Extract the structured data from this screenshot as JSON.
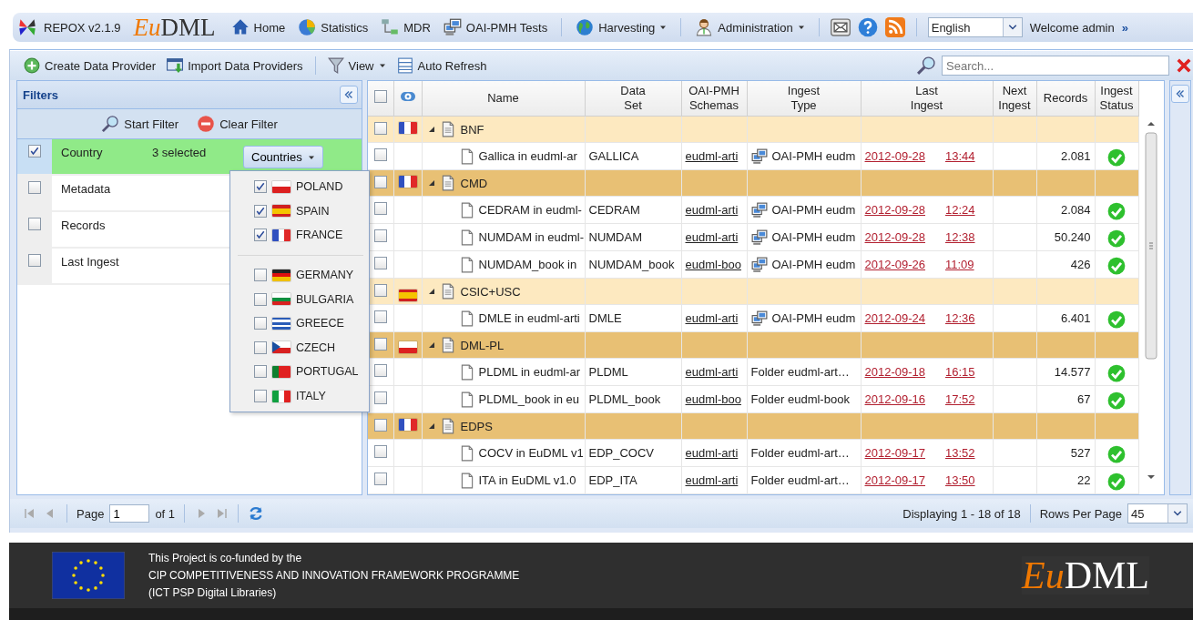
{
  "app": {
    "name": "REPOX v2.1.9",
    "logo_accent": "Eu",
    "logo_main": "DML"
  },
  "nav": [
    {
      "label": "Home",
      "menu": false
    },
    {
      "label": "Statistics",
      "menu": false
    },
    {
      "label": "MDR",
      "menu": false
    },
    {
      "label": "OAI-PMH Tests",
      "menu": false
    },
    {
      "label": "Harvesting",
      "menu": true
    },
    {
      "label": "Administration",
      "menu": true
    }
  ],
  "language": "English",
  "welcome": "Welcome admin",
  "more": "»",
  "toolbar": {
    "items": [
      {
        "label": "Create Data Provider",
        "menu": false
      },
      {
        "label": "Import Data Providers",
        "menu": false
      },
      {
        "label": "View",
        "menu": true
      },
      {
        "label": "Auto Refresh",
        "menu": false
      }
    ],
    "search_placeholder": "Search..."
  },
  "filters": {
    "title": "Filters",
    "actions": [
      "Start Filter",
      "Clear Filter"
    ],
    "rows": [
      {
        "label": "Country",
        "checked": true,
        "active": true,
        "summary": "3 selected",
        "button": "Countries"
      },
      {
        "label": "Metadata",
        "checked": false,
        "active": false
      },
      {
        "label": "Records",
        "checked": false,
        "active": false
      },
      {
        "label": "Last Ingest",
        "checked": false,
        "active": false
      }
    ]
  },
  "countries_menu": {
    "groups": [
      [
        {
          "name": "POLAND",
          "checked": true
        },
        {
          "name": "SPAIN",
          "checked": true
        },
        {
          "name": "FRANCE",
          "checked": true
        }
      ],
      [
        {
          "name": "GERMANY",
          "checked": false
        },
        {
          "name": "BULGARIA",
          "checked": false
        },
        {
          "name": "GREECE",
          "checked": false
        },
        {
          "name": "CZECH",
          "checked": false
        },
        {
          "name": "PORTUGAL",
          "checked": false
        },
        {
          "name": "ITALY",
          "checked": false
        }
      ]
    ]
  },
  "table": {
    "select_all_checked": false,
    "columns": [
      "Name",
      "Data\nSet",
      "OAI-PMH\nSchemas",
      "Ingest\nType",
      "Last\nIngest",
      "Next\nIngest",
      "Records",
      "Ingest\nStatus"
    ],
    "rows": [
      {
        "kind": "group",
        "checked": false,
        "name": "BNF",
        "color": "#fde9c0"
      },
      {
        "kind": "harvest",
        "checked": false,
        "name": "Gallica in eudml-ar",
        "data_set": "GALLICA",
        "schema": "eudml-arti",
        "ingest_type": "OAI-PMH eudm",
        "date": "2012-09-28",
        "time": "13:44",
        "records": "2.081"
      },
      {
        "kind": "group",
        "checked": false,
        "name": "CMD",
        "color": "#e8c074"
      },
      {
        "kind": "harvest",
        "checked": false,
        "name": "CEDRAM in eudml-",
        "data_set": "CEDRAM",
        "schema": "eudml-arti",
        "ingest_type": "OAI-PMH eudm",
        "date": "2012-09-28",
        "time": "12:24",
        "records": "2.084"
      },
      {
        "kind": "harvest",
        "checked": false,
        "name": "NUMDAM in eudml-",
        "data_set": "NUMDAM",
        "schema": "eudml-arti",
        "ingest_type": "OAI-PMH eudm",
        "date": "2012-09-28",
        "time": "12:38",
        "records": "50.240"
      },
      {
        "kind": "harvest",
        "checked": false,
        "name": "NUMDAM_book in",
        "data_set": "NUMDAM_book",
        "schema": "eudml-boo",
        "ingest_type": "OAI-PMH eudm",
        "date": "2012-09-26",
        "time": "11:09",
        "records": "426"
      },
      {
        "kind": "group",
        "checked": false,
        "name": "CSIC+USC",
        "color": "#fde9c0"
      },
      {
        "kind": "harvest",
        "checked": false,
        "name": "DMLE in eudml-arti",
        "data_set": "DMLE",
        "schema": "eudml-arti",
        "ingest_type": "OAI-PMH eudm",
        "date": "2012-09-24",
        "time": "12:36",
        "records": "6.401"
      },
      {
        "kind": "group",
        "checked": false,
        "name": "DML-PL",
        "color": "#e8c074"
      },
      {
        "kind": "folder",
        "checked": false,
        "name": "PLDML in eudml-ar",
        "data_set": "PLDML",
        "schema": "eudml-arti",
        "ingest_type": "Folder eudml-art…",
        "date": "2012-09-18",
        "time": "16:15",
        "records": "14.577"
      },
      {
        "kind": "folder",
        "checked": false,
        "name": "PLDML_book in eu",
        "data_set": "PLDML_book",
        "schema": "eudml-boo",
        "ingest_type": "Folder eudml-book",
        "date": "2012-09-16",
        "time": "17:52",
        "records": "67"
      },
      {
        "kind": "group",
        "checked": false,
        "name": "EDPS",
        "color": "#e8c074"
      },
      {
        "kind": "folder",
        "checked": false,
        "name": "COCV in EuDML v1",
        "data_set": "EDP_COCV",
        "schema": "eudml-arti",
        "ingest_type": "Folder eudml-art…",
        "date": "2012-09-17",
        "time": "13:52",
        "records": "527"
      },
      {
        "kind": "folder",
        "checked": false,
        "name": "ITA in EuDML v1.0",
        "data_set": "EDP_ITA",
        "schema": "eudml-arti",
        "ingest_type": "Folder eudml-art…",
        "date": "2012-09-17",
        "time": "13:50",
        "records": "22"
      }
    ]
  },
  "paging": {
    "page_label": "Page",
    "page": "1",
    "of": "of 1",
    "display": "Displaying 1 - 18 of 18",
    "rows_label": "Rows Per Page",
    "rows_value": "45"
  },
  "footer": {
    "lines": [
      "This Project is co-funded by the",
      "CIP COMPETITIVENESS AND INNOVATION FRAMEWORK PROGRAMME",
      "(ICT PSP Digital Libraries)"
    ],
    "logo_accent": "Eu",
    "logo_main": "DML"
  }
}
